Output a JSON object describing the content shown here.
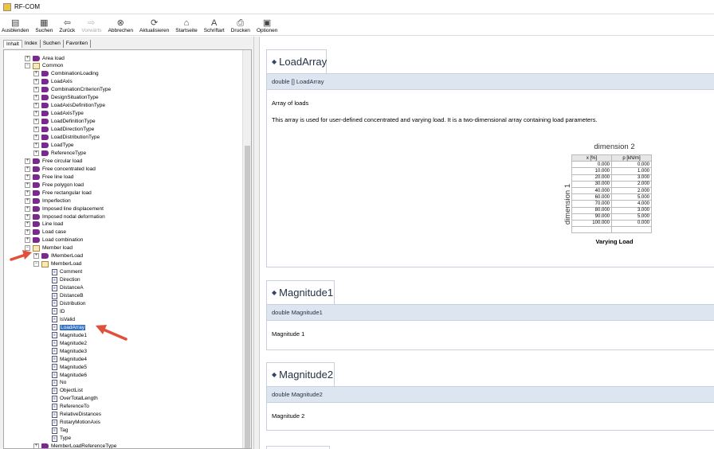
{
  "window": {
    "title": "RF-COM"
  },
  "toolbar": [
    {
      "label": "Ausblenden",
      "icon": "hide-icon",
      "enabled": true
    },
    {
      "label": "Suchen",
      "icon": "search-icon",
      "enabled": true
    },
    {
      "label": "Zurück",
      "icon": "back-arrow-icon",
      "enabled": true
    },
    {
      "label": "Vorwärts",
      "icon": "forward-arrow-icon",
      "enabled": false
    },
    {
      "label": "Abbrechen",
      "icon": "stop-icon",
      "enabled": true
    },
    {
      "label": "Aktualisieren",
      "icon": "refresh-icon",
      "enabled": true
    },
    {
      "label": "Startseite",
      "icon": "home-icon",
      "enabled": true
    },
    {
      "label": "Schriftart",
      "icon": "font-icon",
      "enabled": true
    },
    {
      "label": "Drucken",
      "icon": "print-icon",
      "enabled": true
    },
    {
      "label": "Optionen",
      "icon": "options-icon",
      "enabled": true
    }
  ],
  "nav_tabs": [
    "Inhalt",
    "Index",
    "Suchen",
    "Favoriten"
  ],
  "tree": [
    {
      "label": "Area load",
      "level": 0,
      "type": "book"
    },
    {
      "label": "Common",
      "level": 0,
      "type": "open"
    },
    {
      "label": "CombinationLoading",
      "level": 1,
      "type": "book"
    },
    {
      "label": "LoadAxis",
      "level": 1,
      "type": "book"
    },
    {
      "label": "CombinationCriterionType",
      "level": 1,
      "type": "book"
    },
    {
      "label": "DesignSituationType",
      "level": 1,
      "type": "book"
    },
    {
      "label": "LoadAxisDefinitionType",
      "level": 1,
      "type": "book"
    },
    {
      "label": "LoadAxisType",
      "level": 1,
      "type": "book"
    },
    {
      "label": "LoadDefinitionType",
      "level": 1,
      "type": "book"
    },
    {
      "label": "LoadDirectionType",
      "level": 1,
      "type": "book"
    },
    {
      "label": "LoadDistributionType",
      "level": 1,
      "type": "book"
    },
    {
      "label": "LoadType",
      "level": 1,
      "type": "book"
    },
    {
      "label": "ReferenceType",
      "level": 1,
      "type": "book"
    },
    {
      "label": "Free circular load",
      "level": 0,
      "type": "book"
    },
    {
      "label": "Free concentrated load",
      "level": 0,
      "type": "book"
    },
    {
      "label": "Free line load",
      "level": 0,
      "type": "book"
    },
    {
      "label": "Free polygon load",
      "level": 0,
      "type": "book"
    },
    {
      "label": "Free rectangular load",
      "level": 0,
      "type": "book"
    },
    {
      "label": "Imperfection",
      "level": 0,
      "type": "book"
    },
    {
      "label": "Imposed line displacement",
      "level": 0,
      "type": "book"
    },
    {
      "label": "Imposed nodal deformation",
      "level": 0,
      "type": "book"
    },
    {
      "label": "Line load",
      "level": 0,
      "type": "book"
    },
    {
      "label": "Load case",
      "level": 0,
      "type": "book"
    },
    {
      "label": "Load combination",
      "level": 0,
      "type": "book"
    },
    {
      "label": "Member load",
      "level": 0,
      "type": "open"
    },
    {
      "label": "IMemberLoad",
      "level": 1,
      "type": "book"
    },
    {
      "label": "MemberLoad",
      "level": 1,
      "type": "open"
    },
    {
      "label": "Comment",
      "level": 2,
      "type": "page"
    },
    {
      "label": "Direction",
      "level": 2,
      "type": "page"
    },
    {
      "label": "DistanceA",
      "level": 2,
      "type": "page"
    },
    {
      "label": "DistanceB",
      "level": 2,
      "type": "page"
    },
    {
      "label": "Distribution",
      "level": 2,
      "type": "page"
    },
    {
      "label": "ID",
      "level": 2,
      "type": "page"
    },
    {
      "label": "IsValid",
      "level": 2,
      "type": "page"
    },
    {
      "label": "LoadArray",
      "level": 2,
      "type": "page",
      "selected": true
    },
    {
      "label": "Magnitude1",
      "level": 2,
      "type": "page"
    },
    {
      "label": "Magnitude2",
      "level": 2,
      "type": "page"
    },
    {
      "label": "Magnitude3",
      "level": 2,
      "type": "page"
    },
    {
      "label": "Magnitude4",
      "level": 2,
      "type": "page"
    },
    {
      "label": "Magnitude5",
      "level": 2,
      "type": "page"
    },
    {
      "label": "Magnitude6",
      "level": 2,
      "type": "page"
    },
    {
      "label": "No",
      "level": 2,
      "type": "page"
    },
    {
      "label": "ObjectList",
      "level": 2,
      "type": "page"
    },
    {
      "label": "OverTotalLength",
      "level": 2,
      "type": "page"
    },
    {
      "label": "ReferenceTo",
      "level": 2,
      "type": "page"
    },
    {
      "label": "RelativeDistances",
      "level": 2,
      "type": "page"
    },
    {
      "label": "RotaryMotionAxis",
      "level": 2,
      "type": "page"
    },
    {
      "label": "Tag",
      "level": 2,
      "type": "page"
    },
    {
      "label": "Type",
      "level": 2,
      "type": "page"
    },
    {
      "label": "MemberLoadReferenceType",
      "level": 1,
      "type": "book"
    }
  ],
  "content": {
    "loadarray": {
      "title": "LoadArray",
      "signature": "double [] LoadArray",
      "summary": "Array of loads",
      "description": "This array is used for user-defined concentrated and varying load. It is a two-dimensional array containing load parameters.",
      "figure": {
        "dim2": "dimension 2",
        "dim1": "dimension 1",
        "headers": [
          "x [%]",
          "p [kN/m]"
        ],
        "rows": [
          [
            "0.000",
            "0.000"
          ],
          [
            "10.000",
            "1.000"
          ],
          [
            "20.000",
            "3.000"
          ],
          [
            "30.000",
            "2.000"
          ],
          [
            "40.000",
            "2.000"
          ],
          [
            "60.000",
            "5.000"
          ],
          [
            "70.000",
            "4.000"
          ],
          [
            "80.000",
            "3.000"
          ],
          [
            "90.000",
            "5.000"
          ],
          [
            "100.000",
            "0.000"
          ]
        ],
        "caption": "Varying Load"
      }
    },
    "magnitude1": {
      "title": "Magnitude1",
      "signature": "double Magnitude1",
      "summary": "Magnitude 1"
    },
    "magnitude2": {
      "title": "Magnitude2",
      "signature": "double Magnitude2",
      "summary": "Magnitude 2"
    }
  }
}
